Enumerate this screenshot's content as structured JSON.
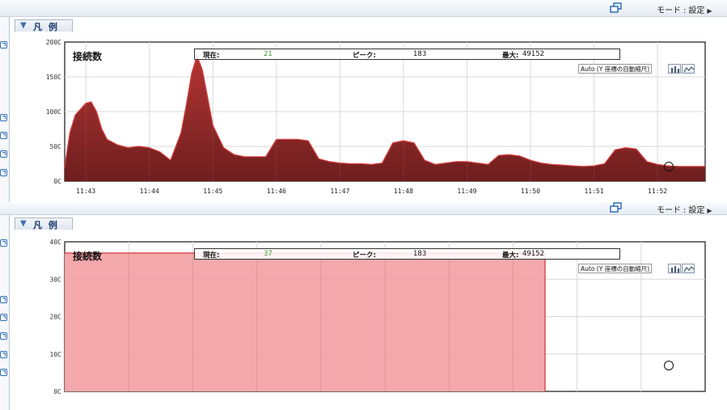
{
  "colors": {
    "accent": "#3a6fb0",
    "area_dark": "#6e1e1e",
    "area_stroke": "#d33a3a",
    "area_light": "#f2a3a8",
    "current_value": "#3a9a2a"
  },
  "toolbar": {
    "mode_label": "モード",
    "mode_sep": ":",
    "mode_value": "設定",
    "arrow_icon": "triangle-right"
  },
  "legend": {
    "label": "凡 例",
    "icon": "collapse-icon"
  },
  "charts": [
    {
      "title": "接続数",
      "stats": {
        "current_label": "現在:",
        "current_value": "21",
        "peak_label": "ピーク:",
        "peak_value": "183",
        "max_label": "最大:",
        "max_value": "49152"
      },
      "scale_label": "Auto (Y 座標の自動縮尺)"
    },
    {
      "title": "接続数",
      "stats": {
        "current_label": "現在:",
        "current_value": "37",
        "peak_label": "ピーク:",
        "peak_value": "183",
        "max_label": "最大:",
        "max_value": "49152"
      },
      "scale_label": "Auto (Y 座標の自動縮尺)"
    }
  ],
  "chart_data": [
    {
      "type": "area",
      "title": "接続数",
      "ylim": [
        0,
        200
      ],
      "yticks": [
        "0C",
        "50C",
        "100C",
        "150C",
        "200C"
      ],
      "xticks": [
        "11:43",
        "11:44",
        "11:45",
        "11:46",
        "11:47",
        "11:48",
        "11:49",
        "11:50",
        "11:51",
        "11:52"
      ],
      "x": [
        "11:42:40",
        "11:42:45",
        "11:42:50",
        "11:43:00",
        "11:43:05",
        "11:43:10",
        "11:43:15",
        "11:43:20",
        "11:43:30",
        "11:43:40",
        "11:43:50",
        "11:44:00",
        "11:44:10",
        "11:44:20",
        "11:44:25",
        "11:44:30",
        "11:44:35",
        "11:44:40",
        "11:44:45",
        "11:44:50",
        "11:44:55",
        "11:45:00",
        "11:45:10",
        "11:45:20",
        "11:45:30",
        "11:45:40",
        "11:45:50",
        "11:46:00",
        "11:46:10",
        "11:46:20",
        "11:46:30",
        "11:46:40",
        "11:46:50",
        "11:47:00",
        "11:47:10",
        "11:47:20",
        "11:47:30",
        "11:47:40",
        "11:47:50",
        "11:48:00",
        "11:48:10",
        "11:48:20",
        "11:48:30",
        "11:48:40",
        "11:48:50",
        "11:49:00",
        "11:49:10",
        "11:49:20",
        "11:49:30",
        "11:49:40",
        "11:49:50",
        "11:50:00",
        "11:50:10",
        "11:50:20",
        "11:50:30",
        "11:50:40",
        "11:50:50",
        "11:51:00",
        "11:51:10",
        "11:51:20",
        "11:51:30",
        "11:51:40",
        "11:51:50",
        "11:52:00",
        "11:52:10",
        "11:52:20",
        "11:52:30",
        "11:52:45"
      ],
      "series": [
        {
          "values": [
            20,
            70,
            95,
            112,
            114,
            100,
            75,
            60,
            52,
            48,
            50,
            48,
            42,
            30,
            50,
            70,
            110,
            155,
            180,
            160,
            120,
            80,
            48,
            38,
            35,
            35,
            35,
            60,
            60,
            60,
            58,
            32,
            28,
            26,
            25,
            25,
            24,
            26,
            55,
            58,
            55,
            30,
            24,
            26,
            28,
            28,
            26,
            24,
            37,
            38,
            36,
            30,
            26,
            24,
            23,
            22,
            21,
            22,
            25,
            45,
            48,
            46,
            28,
            24,
            22,
            21,
            21,
            21
          ]
        }
      ],
      "marker": {
        "x": "11:52:00",
        "y": 21
      }
    },
    {
      "type": "area",
      "title": "接続数",
      "ylim": [
        0,
        40
      ],
      "yticks": [
        "0C",
        "10C",
        "20C",
        "30C",
        "40C"
      ],
      "series": [
        {
          "values": [
            37,
            37
          ]
        }
      ],
      "fill_fraction": 0.75,
      "marker": {
        "y": 8
      }
    }
  ]
}
